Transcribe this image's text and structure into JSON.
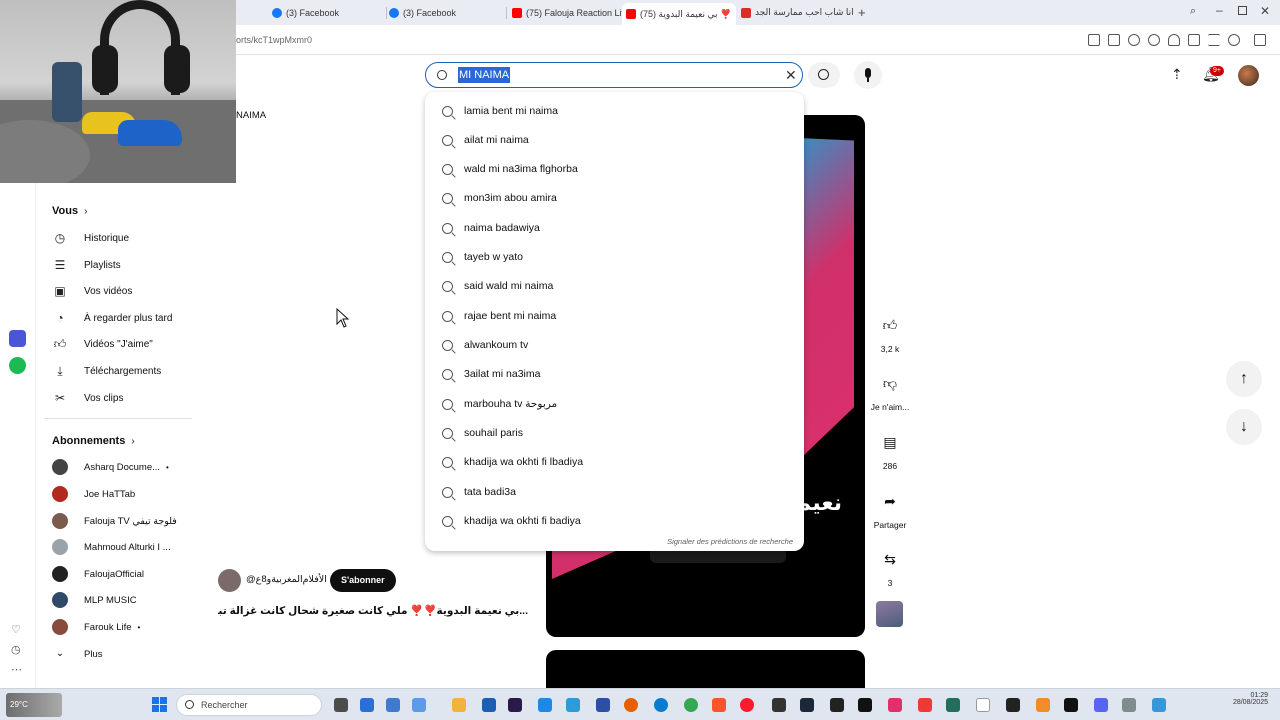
{
  "browser": {
    "tabs": [
      {
        "label": "(3) Facebook",
        "favicon_color": "#1877f2"
      },
      {
        "label": "(3) Facebook",
        "favicon_color": "#1877f2"
      },
      {
        "label": "(75) Falouja Reaction Live",
        "favicon_color": "#ff0000"
      },
      {
        "label": "(75) بي نعيمة البدوية ❣️",
        "favicon_color": "#ff0000"
      },
      {
        "label": "انا شاب احب ممارسة الجد...",
        "favicon_color": "#d93025"
      }
    ],
    "url_fragment": "orts/kcT1wpMxmr0"
  },
  "youtube": {
    "search": {
      "query": "MI NAIMA",
      "suggestions": [
        "lamia bent mi naima",
        "ailat mi naima",
        "wald mi na3ima flghorba",
        "mon3im abou amira",
        "naima badawiya",
        "tayeb w yato",
        "said wald mi naima",
        "rajae bent mi naima",
        "alwankoum tv",
        "3ailat mi na3ima",
        "marbouha tv مربوحة",
        "souhail paris",
        "khadija wa okhti fi lbadiya",
        "tata badi3a",
        "khadija wa okhti fi badiya"
      ],
      "report_label": "Signaler des prédictions de recherche"
    },
    "partial_label": "NAIMA",
    "notif_badge": "9+",
    "sidebar": {
      "you_header": "Vous",
      "you_items": [
        {
          "label": "Historique",
          "icon": "history-icon"
        },
        {
          "label": "Playlists",
          "icon": "playlists-icon"
        },
        {
          "label": "Vos vidéos",
          "icon": "your-videos-icon"
        },
        {
          "label": "À regarder plus tard",
          "icon": "watch-later-icon"
        },
        {
          "label": "Vidéos \"J'aime\"",
          "icon": "liked-icon"
        },
        {
          "label": "Téléchargements",
          "icon": "download-icon"
        },
        {
          "label": "Vos clips",
          "icon": "clips-icon"
        }
      ],
      "subs_header": "Abonnements",
      "subs": [
        {
          "label": "Asharq Docume...",
          "dot": "•",
          "color": "#444"
        },
        {
          "label": "Joe HaTTab",
          "dot": "",
          "color": "#b12a1f"
        },
        {
          "label": "Falouja TV فلوجة تيفي",
          "dot": "",
          "color": "#7a5c4c"
        },
        {
          "label": "Mahmoud Alturki I ...",
          "dot": "",
          "color": "#9aa3ab"
        },
        {
          "label": "FaloujaOfficial",
          "dot": "",
          "color": "#222"
        },
        {
          "label": "MLP MUSIC",
          "dot": "",
          "color": "#2f4a66"
        },
        {
          "label": "Farouk Life",
          "dot": "•",
          "color": "#8a4a3c"
        }
      ],
      "more_label": "Plus"
    },
    "short": {
      "channel": "@الأفلام‌المغربية‌و8ع",
      "subscribe_label": "S'abonner",
      "title": "...بي نعيمة البدوية❣️❣️ ملي كانت صغيرة شحال كانت غزالة تبارك الله 🥰",
      "overlay_text": "نعيمة",
      "likes": "3,2 k",
      "dislike_label": "Je n'aim...",
      "comments": "286",
      "share_label": "Partager",
      "remix_count": "3"
    }
  },
  "taskbar": {
    "search_placeholder": "Rechercher",
    "time": "01:29",
    "date": "28/08/2025",
    "weather": "29°C"
  }
}
